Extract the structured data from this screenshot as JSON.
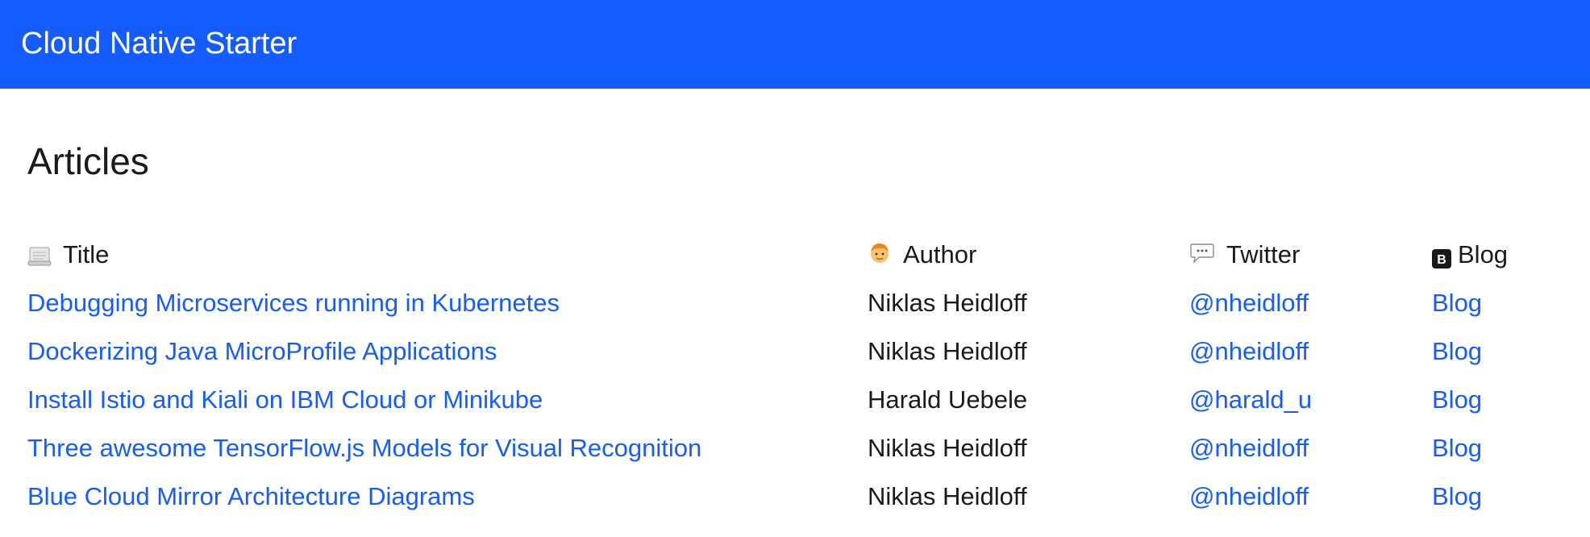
{
  "app": {
    "title": "Cloud Native Starter"
  },
  "page": {
    "heading": "Articles"
  },
  "colors": {
    "brand": "#155cff",
    "link": "#155cff",
    "text": "#1a1a1a"
  },
  "table": {
    "headers": {
      "title": {
        "label": "Title",
        "icon": "scroll-icon"
      },
      "author": {
        "label": "Author",
        "icon": "person-face-icon"
      },
      "twitter": {
        "label": "Twitter",
        "icon": "speech-bubble-icon"
      },
      "blog": {
        "label": "Blog",
        "icon": "letter-b-icon"
      }
    },
    "rows": [
      {
        "title": "Debugging Microservices running in Kubernetes",
        "author": "Niklas Heidloff",
        "twitter": "@nheidloff",
        "blog": "Blog"
      },
      {
        "title": "Dockerizing Java MicroProfile Applications",
        "author": "Niklas Heidloff",
        "twitter": "@nheidloff",
        "blog": "Blog"
      },
      {
        "title": "Install Istio and Kiali on IBM Cloud or Minikube",
        "author": "Harald Uebele",
        "twitter": "@harald_u",
        "blog": "Blog"
      },
      {
        "title": "Three awesome TensorFlow.js Models for Visual Recognition",
        "author": "Niklas Heidloff",
        "twitter": "@nheidloff",
        "blog": "Blog"
      },
      {
        "title": "Blue Cloud Mirror Architecture Diagrams",
        "author": "Niklas Heidloff",
        "twitter": "@nheidloff",
        "blog": "Blog"
      }
    ]
  }
}
